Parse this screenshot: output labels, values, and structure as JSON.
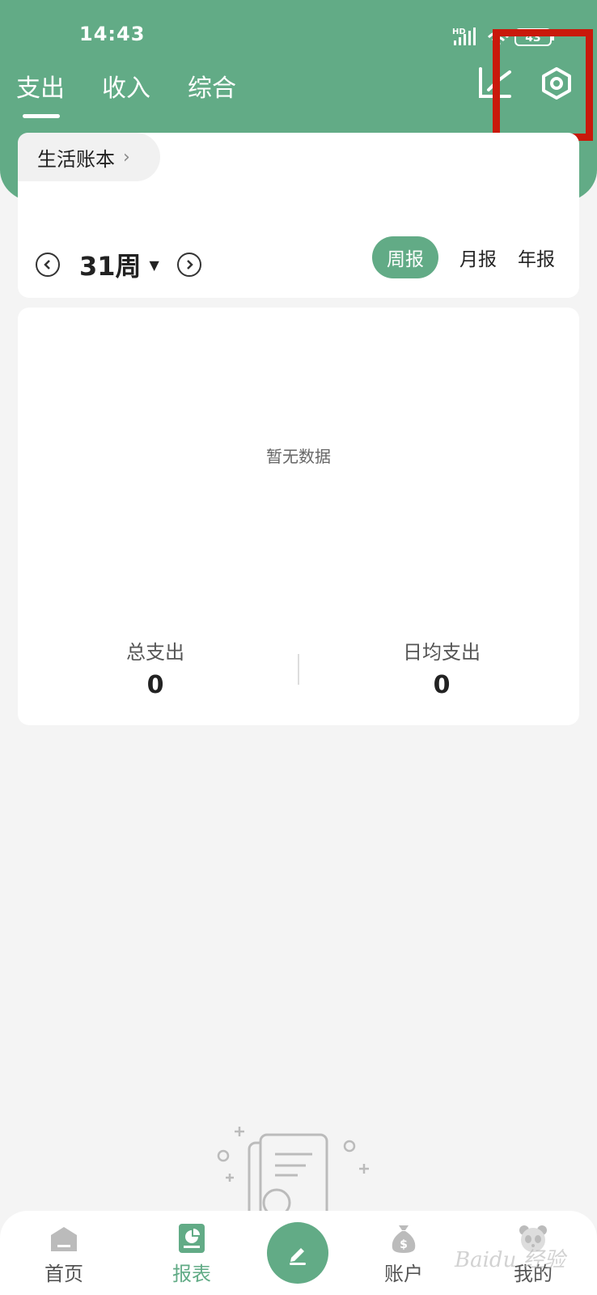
{
  "status_bar": {
    "time": "14:43",
    "battery": "43",
    "network": "HD"
  },
  "tabs": [
    {
      "label": "支出",
      "active": true
    },
    {
      "label": "收入",
      "active": false
    },
    {
      "label": "综合",
      "active": false
    }
  ],
  "account_book": {
    "label": "生活账本"
  },
  "period": {
    "week_label": "31周",
    "options": [
      {
        "label": "周报",
        "active": true
      },
      {
        "label": "月报",
        "active": false
      },
      {
        "label": "年报",
        "active": false
      }
    ]
  },
  "chart": {
    "empty_text": "暂无数据"
  },
  "stats": {
    "total_label": "总支出",
    "total_value": "0",
    "daily_label": "日均支出",
    "daily_value": "0"
  },
  "bottom_nav": [
    {
      "label": "首页",
      "icon": "home-icon",
      "active": false
    },
    {
      "label": "报表",
      "icon": "report-icon",
      "active": true
    },
    {
      "label": "账户",
      "icon": "money-bag-icon",
      "active": false
    },
    {
      "label": "我的",
      "icon": "panda-avatar-icon",
      "active": false
    }
  ],
  "watermark": "Baidu 经验",
  "colors": {
    "primary": "#62ab86",
    "highlight": "#c9190b",
    "background": "#f4f4f4"
  }
}
